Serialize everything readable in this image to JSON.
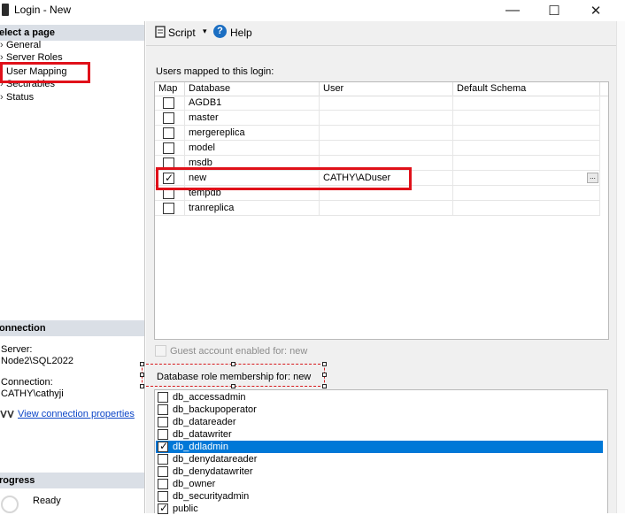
{
  "window": {
    "title": "Login - New",
    "minimize": "—",
    "maximize": "☐",
    "close": "✕"
  },
  "left": {
    "select_page": "elect a page",
    "pages": [
      {
        "label": "General"
      },
      {
        "label": "Server Roles"
      },
      {
        "label": "User Mapping"
      },
      {
        "label": "Securables"
      },
      {
        "label": "Status"
      }
    ],
    "connection_header": "onnection",
    "server_label": "Server:",
    "server_value": "Node2\\SQL2022",
    "connection_label": "Connection:",
    "connection_value": "CATHY\\cathyji",
    "view_connection": "View connection properties",
    "progress_header": "rogress",
    "progress_status": "Ready"
  },
  "toolbar": {
    "script_label": "Script",
    "help_label": "Help"
  },
  "users": {
    "caption": "Users mapped to this login:",
    "headers": [
      "Map",
      "Database",
      "User",
      "Default Schema"
    ],
    "rows": [
      {
        "db": "AGDB1",
        "user": "",
        "schema": "",
        "checked": false
      },
      {
        "db": "master",
        "user": "",
        "schema": "",
        "checked": false
      },
      {
        "db": "mergereplica",
        "user": "",
        "schema": "",
        "checked": false
      },
      {
        "db": "model",
        "user": "",
        "schema": "",
        "checked": false
      },
      {
        "db": "msdb",
        "user": "",
        "schema": "",
        "checked": false
      },
      {
        "db": "new",
        "user": "CATHY\\ADuser",
        "schema": "",
        "checked": true
      },
      {
        "db": "tempdb",
        "user": "",
        "schema": "",
        "checked": false
      },
      {
        "db": "tranreplica",
        "user": "",
        "schema": "",
        "checked": false
      }
    ],
    "ellipsis": "..."
  },
  "guest": {
    "label": "Guest account enabled for: new"
  },
  "roles": {
    "caption": "Database role membership for: new",
    "items": [
      {
        "name": "db_accessadmin",
        "checked": false
      },
      {
        "name": "db_backupoperator",
        "checked": false
      },
      {
        "name": "db_datareader",
        "checked": false
      },
      {
        "name": "db_datawriter",
        "checked": false
      },
      {
        "name": "db_ddladmin",
        "checked": true
      },
      {
        "name": "db_denydatareader",
        "checked": false
      },
      {
        "name": "db_denydatawriter",
        "checked": false
      },
      {
        "name": "db_owner",
        "checked": false
      },
      {
        "name": "db_securityadmin",
        "checked": false
      },
      {
        "name": "public",
        "checked": true
      }
    ]
  },
  "colors": {
    "accent": "#0078d7",
    "highlight_red": "#e0111a",
    "section_bg": "#dadfe6",
    "link": "#0b45c7"
  },
  "icons": {
    "app": "app-icon",
    "script": "script-icon",
    "dropdown": "chevron-down-icon",
    "help": "help-icon",
    "connection": "connection-icon"
  }
}
